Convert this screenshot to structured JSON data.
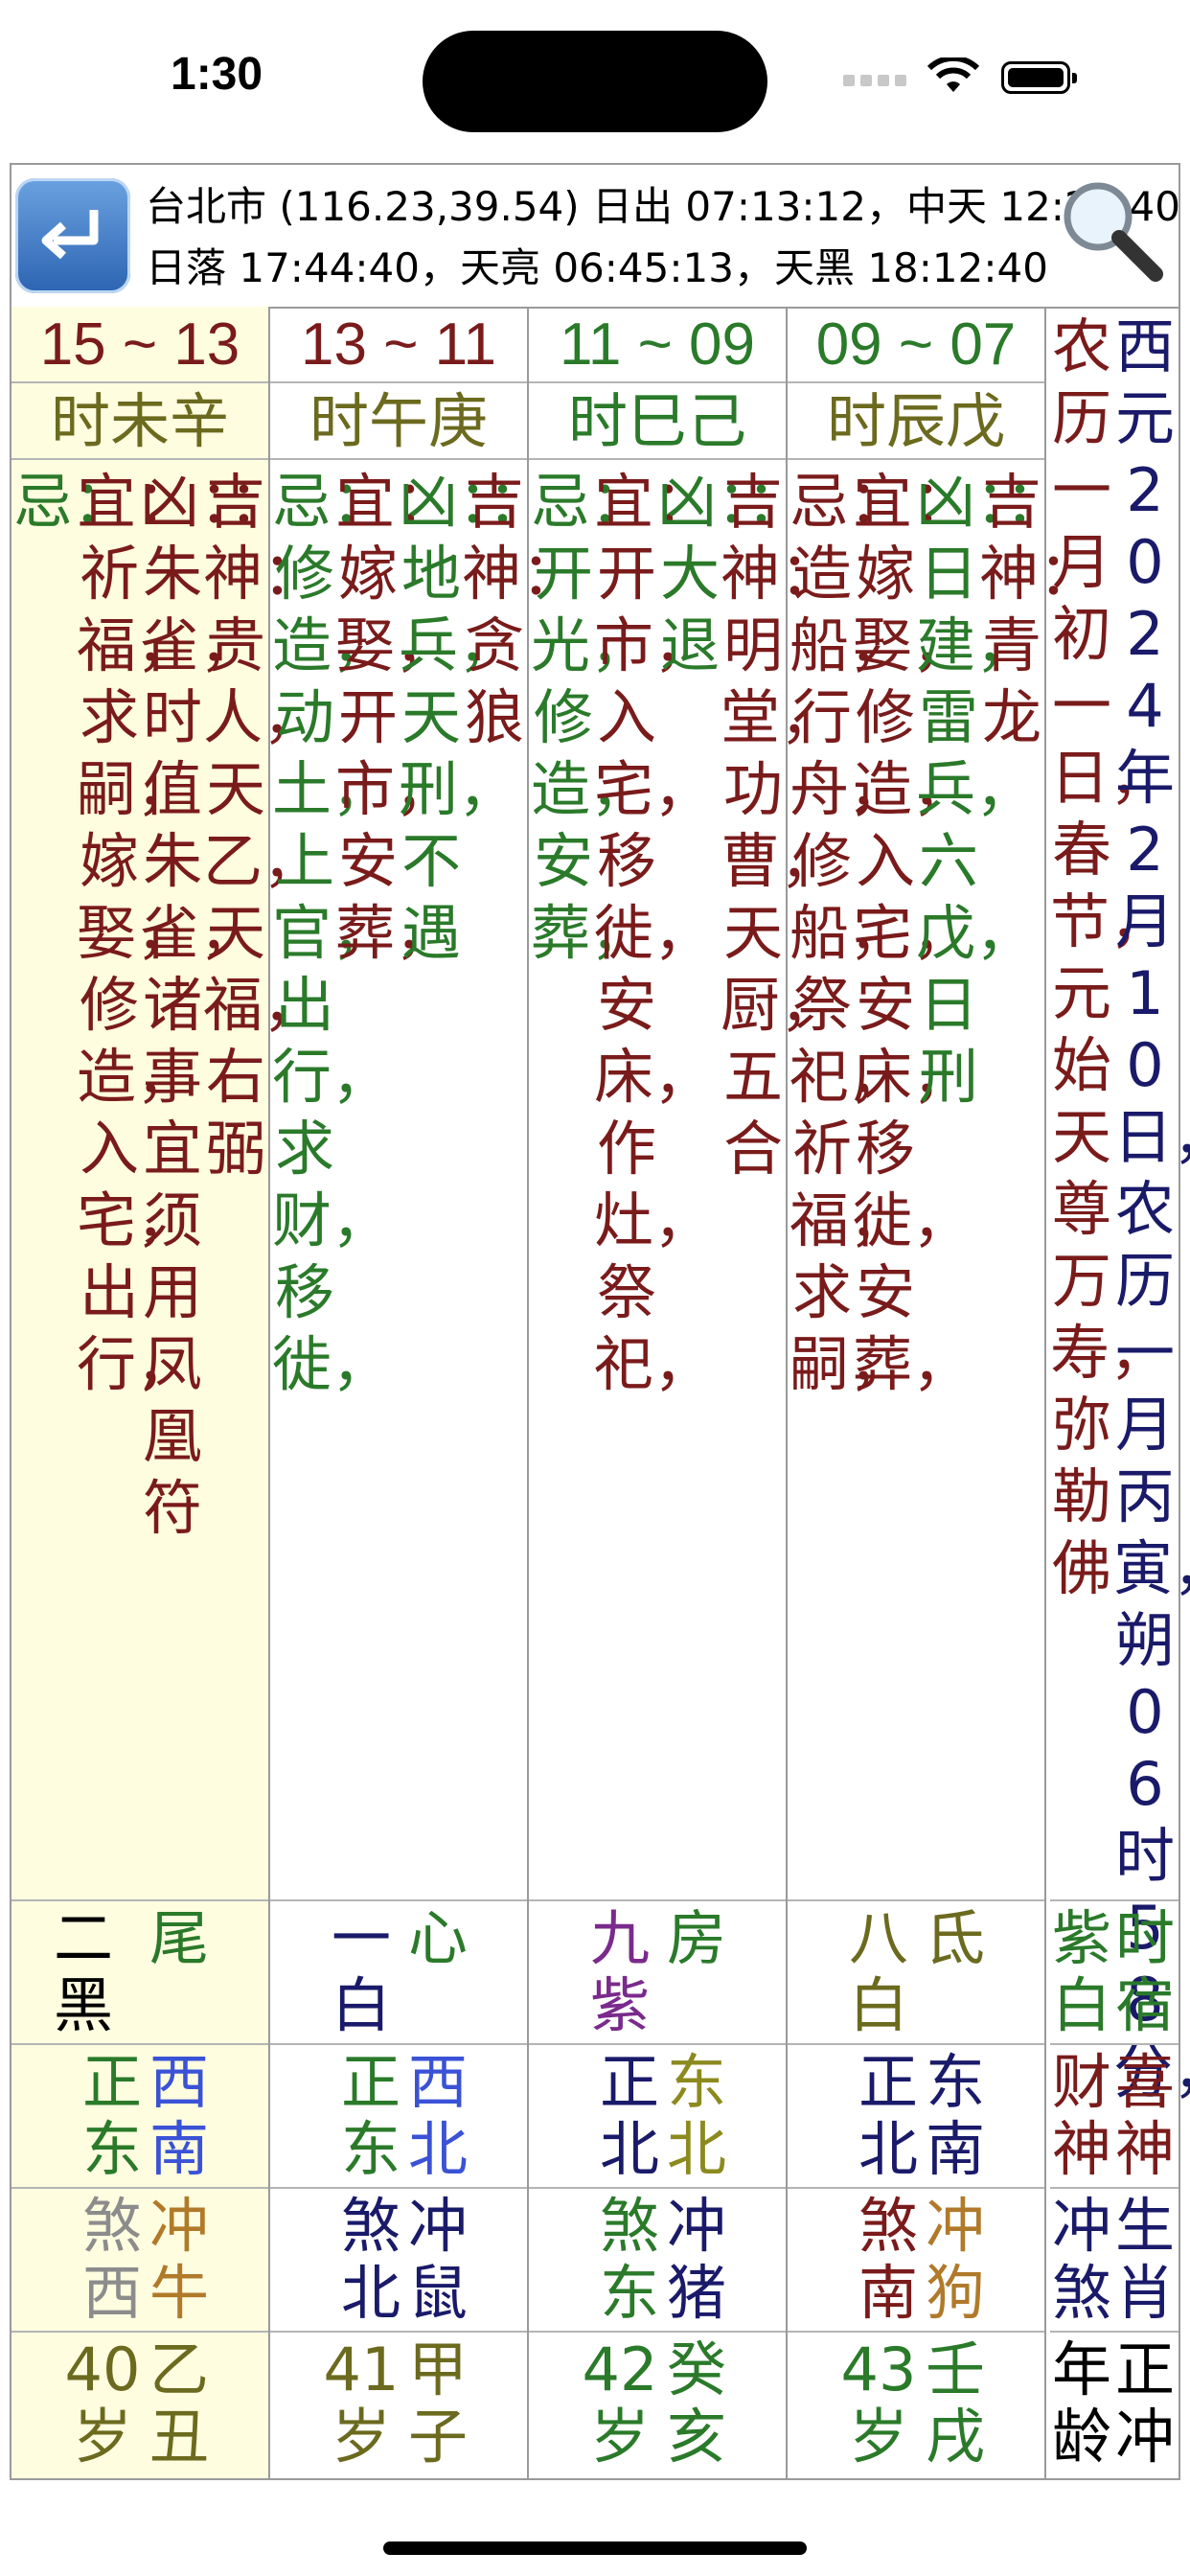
{
  "status_bar": {
    "time": "1:30"
  },
  "header": {
    "line1": "台北市 (116.23,39.54) 日出 07:13:12，中天 12:28:40",
    "line2": "日落 17:44:40，天亮 06:45:13，天黑 18:12:40"
  },
  "columns": [
    {
      "hour": "15 ~ 13",
      "ganzhi": "时未辛",
      "luck": [
        "忌：",
        "宜：祈福，求嗣，嫁娶，修造，入宅，出行，",
        "凶：：朱雀，时值朱雀，诸事宜须用凤凰符",
        "吉神：贵人，天乙，天福，右弼"
      ],
      "star": [
        "尾",
        "二黑"
      ],
      "direction": [
        "西南",
        "正东"
      ],
      "clash": [
        "冲牛",
        "煞西"
      ],
      "age": [
        "乙丑",
        "40岁"
      ]
    },
    {
      "hour": "13 ~ 11",
      "ganzhi": "时午庚",
      "luck": [
        "忌：修造，动土，上官，出行，求财，移徙，",
        "宜：嫁娶，开市，安葬，",
        "凶：：地兵，天刑，不遇",
        "吉神：贪狼"
      ],
      "star": [
        "心",
        "一白"
      ],
      "direction": [
        "西北",
        "正东"
      ],
      "clash": [
        "冲鼠",
        "煞北"
      ],
      "age": [
        "甲子",
        "41岁"
      ]
    },
    {
      "hour": "11 ~ 09",
      "ganzhi": "时巳己",
      "luck": [
        "忌：开光，修造，安葬，",
        "宜：开市，入宅，移徙，安床，作灶，祭祀，",
        "凶：：大退",
        "吉神：明堂，功曹，天厨，五合"
      ],
      "star": [
        "房",
        "九紫"
      ],
      "direction": [
        "东北",
        "正北"
      ],
      "clash": [
        "冲猪",
        "煞东"
      ],
      "age": [
        "癸亥",
        "42岁"
      ]
    },
    {
      "hour": "09 ~ 07",
      "ganzhi": "时辰戊",
      "luck": [
        "忌：造船，行舟，修船，祭祀，祈福，求嗣，",
        "宜：嫁娶，修造，入宅，安床，移徙，安葬，",
        "凶：：日建，雷兵，六戊，日刑",
        "吉神：青龙"
      ],
      "star": [
        "氐",
        "八白"
      ],
      "direction": [
        "东南",
        "正北"
      ],
      "clash": [
        "冲狗",
        "煞南"
      ],
      "age": [
        "壬戌",
        "43岁"
      ]
    }
  ],
  "side": {
    "lunar_label": "农历一月初一日，春节，元始天尊万寿，弥勒佛",
    "date_label": "西元2024年2月10日，农历一月丙寅，朔06时58分，",
    "star_label": [
      "时宿",
      "紫白"
    ],
    "direction_label": [
      "喜神",
      "财神"
    ],
    "clash_label": [
      "生肖",
      "冲煞"
    ],
    "age_label": [
      "正冲",
      "年龄"
    ]
  },
  "colors": {
    "hour_col1": "#7a1b1b",
    "hour_col2": "#7a1b1b",
    "hour_col3": "#2a7a2a",
    "hour_col4": "#2a7a2a",
    "ganzhi": "#6b6a1e",
    "ji": "#2a7a2a",
    "yi": "#7a1b1b",
    "xiong": "#2a7a2a",
    "ji_shen": "#7a1b1b",
    "highlight_bg": "#fffde0",
    "side_dark": "#1a1a6a",
    "side_red": "#7a1b1b"
  }
}
